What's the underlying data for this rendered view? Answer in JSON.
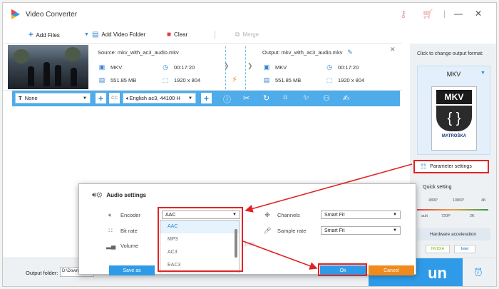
{
  "app": {
    "title": "Video Converter"
  },
  "toolbar": {
    "add_files": "Add Files",
    "add_video_folder": "Add Video Folder",
    "clear": "Clear",
    "merge": "Merge"
  },
  "file": {
    "source": "Source: mkv_with_ac3_audio.mkv",
    "output": "Output: mkv_with_ac3_audio.mkv",
    "src_format": "MKV",
    "src_duration": "00:17:20",
    "src_size": "551.85 MB",
    "src_resolution": "1920 x 804",
    "out_format": "MKV",
    "out_duration": "00:17:20",
    "out_size": "551.85 MB",
    "out_resolution": "1920 x 804"
  },
  "editbar": {
    "subtitle": "None",
    "audio_track": "English ac3, 44100 H"
  },
  "right_panel": {
    "hint": "Click to change output format:",
    "format": "MKV",
    "logo_top": "MKV",
    "logo_bottom": "MATROŠKA",
    "parameter_settings": "Parameter settings",
    "quick_setting": "Quick setting",
    "ticks_top": [
      "480P",
      "1080P",
      "4K"
    ],
    "ticks_bottom": [
      "ault",
      "720P",
      "2K"
    ],
    "hardware_acceleration": "Hardware acceleration",
    "nvidia": "NVIDIA",
    "intel": "Intel"
  },
  "bottom": {
    "output_folder_label": "Output folder:",
    "output_folder_value": "D:\\Downlo",
    "run": "un"
  },
  "modal": {
    "title": "Audio settings",
    "encoder_label": "Encoder",
    "encoder_value": "AAC",
    "bitrate_label": "Bit rate",
    "volume_label": "Volume",
    "volume_value": "100%",
    "channels_label": "Channels",
    "channels_value": "Smart Fit",
    "sample_rate_label": "Sample rate",
    "sample_rate_value": "Smart Fit",
    "encoder_options": [
      "AAC",
      "MP3",
      "AC3",
      "EAC3"
    ],
    "save_as": "Save as",
    "ok": "Ok",
    "cancel": "Cancel"
  },
  "colors": {
    "accent": "#2f9be8",
    "highlight": "#e02424",
    "cancel": "#f08a1c"
  }
}
